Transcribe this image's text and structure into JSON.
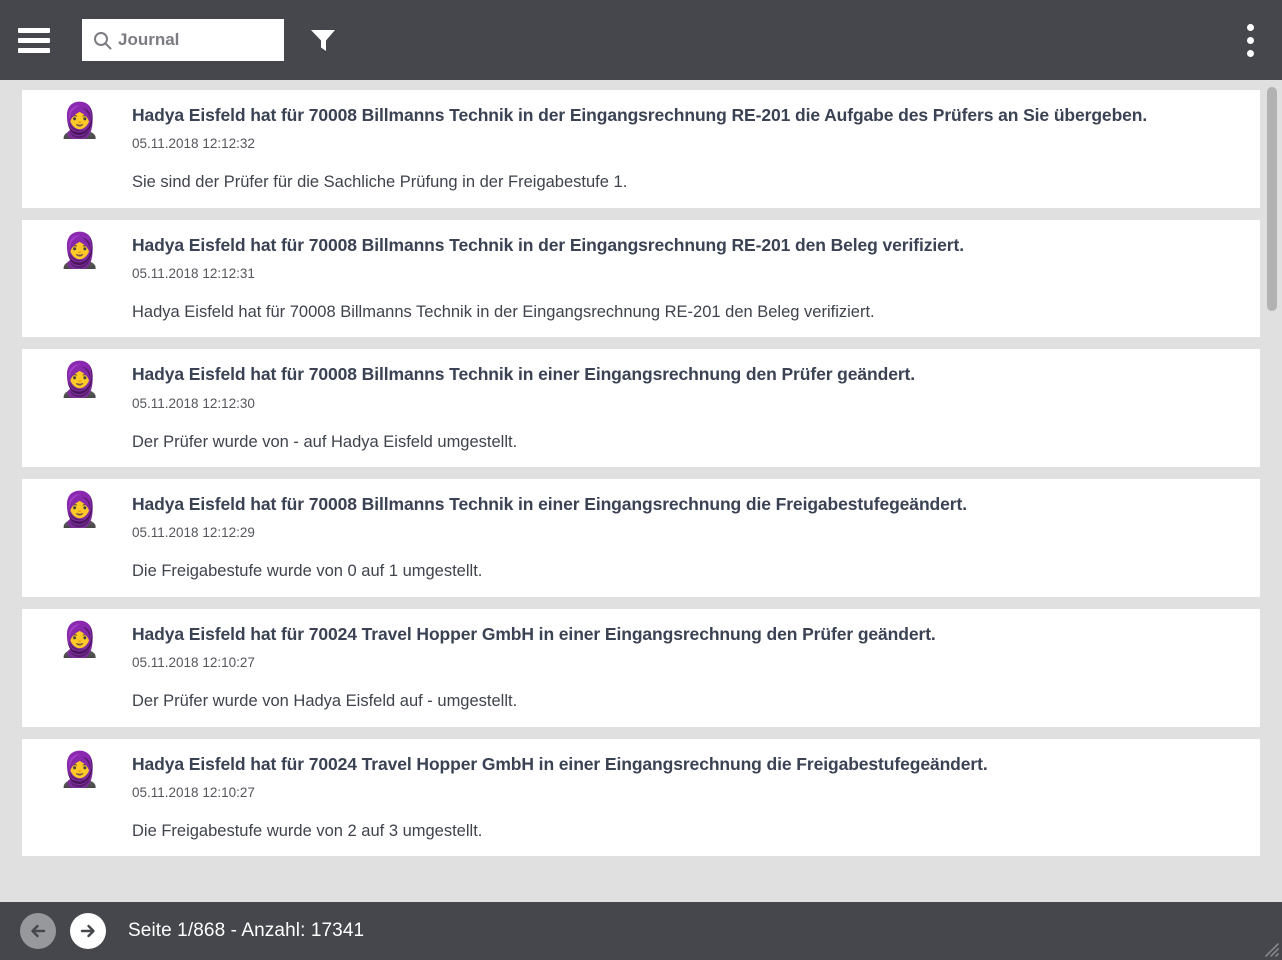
{
  "header": {
    "menu_icon": "hamburger-icon",
    "search": {
      "icon": "search-icon",
      "value": "",
      "placeholder": "Journal"
    },
    "filter_icon": "filter-funnel-icon",
    "overflow_icon": "kebab-menu-icon"
  },
  "colors": {
    "chrome": "#46474c",
    "page_background": "#e0e0e0",
    "card": "#ffffff",
    "title_text": "#3a4254",
    "body_text": "#3f434d",
    "meta_text": "#54565c",
    "scrollbar_thumb": "#b2b2b2",
    "nav_disabled": "#97989c",
    "nav_enabled": "#ffffff"
  },
  "journal": {
    "entries": [
      {
        "avatar": "woman-with-headscarf-emoji",
        "title": "Hadya Eisfeld hat für 70008 Billmanns Technik in der Eingangsrechnung RE-201 die Aufgabe des Prüfers an Sie übergeben.",
        "timestamp": "05.11.2018 12:12:32",
        "text": "Sie sind der Prüfer für die Sachliche Prüfung in der Freigabestufe 1."
      },
      {
        "avatar": "woman-with-headscarf-emoji",
        "title": "Hadya Eisfeld hat für 70008 Billmanns Technik in der Eingangsrechnung RE-201 den Beleg verifiziert.",
        "timestamp": "05.11.2018 12:12:31",
        "text": "Hadya Eisfeld hat für 70008 Billmanns Technik in der Eingangsrechnung RE-201 den Beleg verifiziert."
      },
      {
        "avatar": "woman-with-headscarf-emoji",
        "title": "Hadya Eisfeld hat für 70008 Billmanns Technik in einer Eingangsrechnung den Prüfer geändert.",
        "timestamp": "05.11.2018 12:12:30",
        "text": "Der Prüfer wurde von - auf Hadya Eisfeld umgestellt."
      },
      {
        "avatar": "woman-with-headscarf-emoji",
        "title": "Hadya Eisfeld hat für 70008 Billmanns Technik in einer Eingangsrechnung die Freigabestufegeändert.",
        "timestamp": "05.11.2018 12:12:29",
        "text": "Die Freigabestufe wurde von 0 auf 1 umgestellt."
      },
      {
        "avatar": "woman-with-headscarf-emoji",
        "title": "Hadya Eisfeld hat für 70024 Travel Hopper GmbH in einer Eingangsrechnung den Prüfer geändert.",
        "timestamp": "05.11.2018 12:10:27",
        "text": "Der Prüfer wurde von Hadya Eisfeld auf - umgestellt."
      },
      {
        "avatar": "woman-with-headscarf-emoji",
        "title": "Hadya Eisfeld hat für 70024 Travel Hopper GmbH in einer Eingangsrechnung die Freigabestufegeändert.",
        "timestamp": "05.11.2018 12:10:27",
        "text": "Die Freigabestufe wurde von 2 auf 3 umgestellt."
      }
    ]
  },
  "footer": {
    "prev_icon": "arrow-left-circle-icon",
    "next_icon": "arrow-right-circle-icon",
    "prev_enabled": false,
    "next_enabled": true,
    "status": "Seite 1/868 - Anzahl: 17341",
    "page_current": 1,
    "page_total": 868,
    "record_count": 17341,
    "resize_icon": "resize-grip-icon"
  }
}
